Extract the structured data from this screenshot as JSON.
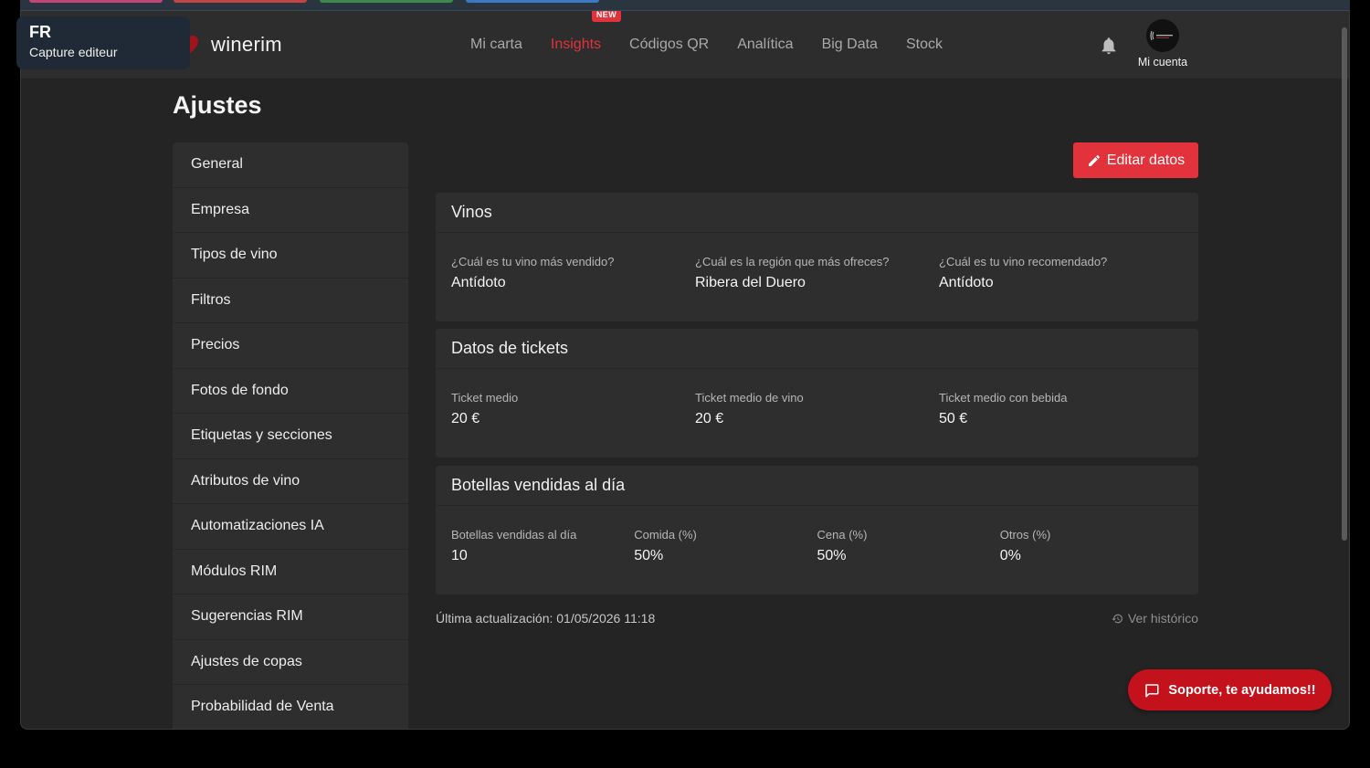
{
  "overlay": {
    "lang_code": "FR",
    "subtitle": "Capture editeur"
  },
  "header": {
    "brand": "winerim",
    "nav": [
      {
        "label": "Mi carta",
        "active": false
      },
      {
        "label": "Insights",
        "active": true,
        "badge": "NEW"
      },
      {
        "label": "Códigos QR",
        "active": false
      },
      {
        "label": "Analítica",
        "active": false
      },
      {
        "label": "Big Data",
        "active": false
      },
      {
        "label": "Stock",
        "active": false
      }
    ],
    "account_label": "Mi cuenta"
  },
  "page": {
    "title": "Ajustes",
    "edit_button": "Editar datos"
  },
  "sidebar": {
    "items": [
      "General",
      "Empresa",
      "Tipos de vino",
      "Filtros",
      "Precios",
      "Fotos de fondo",
      "Etiquetas y secciones",
      "Atributos de vino",
      "Automatizaciones IA",
      "Módulos RIM",
      "Sugerencias RIM",
      "Ajustes de copas",
      "Probabilidad de Venta"
    ]
  },
  "cards": {
    "vinos": {
      "title": "Vinos",
      "fields": [
        {
          "label": "¿Cuál es tu vino más vendido?",
          "value": "Antídoto"
        },
        {
          "label": "¿Cuál es la región que más ofreces?",
          "value": "Ribera del Duero"
        },
        {
          "label": "¿Cuál es tu vino recomendado?",
          "value": "Antídoto"
        }
      ]
    },
    "tickets": {
      "title": "Datos de tickets",
      "fields": [
        {
          "label": "Ticket medio",
          "value": "20 €"
        },
        {
          "label": "Ticket medio de vino",
          "value": "20 €"
        },
        {
          "label": "Ticket medio con bebida",
          "value": "50 €"
        }
      ]
    },
    "botellas": {
      "title": "Botellas vendidas al día",
      "fields": [
        {
          "label": "Botellas vendidas al día",
          "value": "10"
        },
        {
          "label": "Comida (%)",
          "value": "50%"
        },
        {
          "label": "Cena (%)",
          "value": "50%"
        },
        {
          "label": "Otros (%)",
          "value": "0%"
        }
      ]
    }
  },
  "footer": {
    "last_update": "Última actualización: 01/05/2026 11:18",
    "history_link": "Ver histórico"
  },
  "support_button": "Soporte, te ayudamos!!",
  "colors": {
    "accent": "#e2323b",
    "support": "#c4121d",
    "background": "#242424",
    "panel": "#2e2e2e"
  }
}
